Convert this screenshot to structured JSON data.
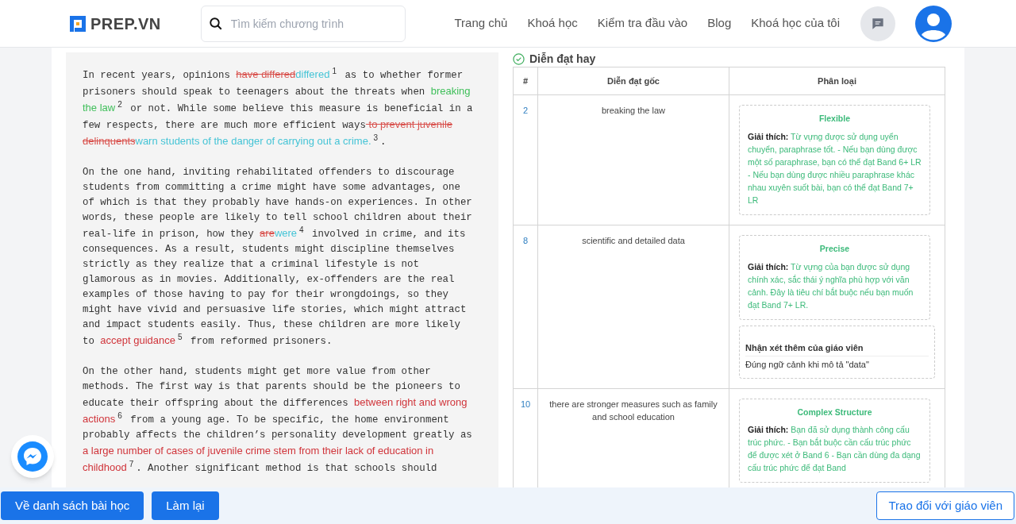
{
  "header": {
    "logo": "PREP.VN",
    "search": {
      "placeholder": "Tìm kiếm chương trình"
    },
    "nav": [
      {
        "label": "Trang chủ"
      },
      {
        "label": "Khoá học"
      },
      {
        "label": "Kiểm tra đầu vào"
      },
      {
        "label": "Blog"
      },
      {
        "label": "Khoá học của tôi"
      }
    ]
  },
  "essay": {
    "paragraphs": [
      [
        {
          "kind": "text",
          "text": "In recent years, opinions "
        },
        {
          "kind": "del",
          "text": "have differed"
        },
        {
          "kind": "ins",
          "text": "differed"
        },
        {
          "kind": "ref",
          "text": "1"
        },
        {
          "kind": "text",
          "text": " as to whether former prisoners should speak to teenagers about the threats when "
        },
        {
          "kind": "good",
          "text": "breaking the law"
        },
        {
          "kind": "ref",
          "text": "2"
        },
        {
          "kind": "text",
          "text": " or not. While some believe this measure is beneficial in a few respects, there are much more efficient ways"
        },
        {
          "kind": "del",
          "text": " to prevent juvenile delinquents"
        },
        {
          "kind": "ins",
          "text": "warn students of the danger of carrying out a crime."
        },
        {
          "kind": "ref",
          "text": "3"
        },
        {
          "kind": "text",
          "text": "."
        }
      ],
      [
        {
          "kind": "text",
          "text": "On the one hand, inviting rehabilitated offenders to discourage students from committing a crime might have some advantages, one of which is that they probably have hands-on experiences. In other words, these people are likely to tell school children about their real-life in prison, how they "
        },
        {
          "kind": "del",
          "text": "are"
        },
        {
          "kind": "ins",
          "text": "were"
        },
        {
          "kind": "ref",
          "text": "4"
        },
        {
          "kind": "text",
          "text": " involved in crime, and its consequences. As a result, students might discipline themselves strictly as they realize that a criminal lifestyle is not glamorous as in movies. Additionally, ex-offenders are the real examples of those having to pay for their wrongdoings, so they might have vivid and persuasive life stories, which might attract and impact students easily. Thus, these children are more likely to "
        },
        {
          "kind": "bad",
          "text": "accept guidance"
        },
        {
          "kind": "ref",
          "text": "5"
        },
        {
          "kind": "text",
          "text": " from reformed prisoners."
        }
      ],
      [
        {
          "kind": "text",
          "text": "On the other hand, students might get more value from other methods. The first way is that parents should be the pioneers to educate their offspring about the differences "
        },
        {
          "kind": "bad",
          "text": "between right and wrong actions"
        },
        {
          "kind": "ref",
          "text": "6"
        },
        {
          "kind": "text",
          "text": " from a young age. To be specific, the home environment probably affects the children’s personality development greatly as "
        },
        {
          "kind": "bad",
          "text": "a large number of cases of juvenile crime stem from their lack of education in childhood"
        },
        {
          "kind": "ref",
          "text": "7"
        },
        {
          "kind": "text",
          "text": ". Another significant method is that schools should"
        }
      ]
    ]
  },
  "review": {
    "title": "Diễn đạt hay",
    "columns": [
      "#",
      "Diễn đạt gốc",
      "Phân loại"
    ],
    "rows": [
      {
        "number": "2",
        "original": "breaking the law",
        "category": "Flexible",
        "explanation_label": "Giải thích:",
        "explanation": "Từ vựng được sử dụng uyển chuyển, paraphrase tốt. - Nếu bạn dùng được một số paraphrase, bạn có thể đạt Band 6+ LR - Nếu bạn dùng được nhiều paraphrase khác nhau xuyên suốt bài, bạn có thể đạt Band 7+ LR"
      },
      {
        "number": "8",
        "original": "scientific and detailed data",
        "category": "Precise",
        "explanation_label": "Giải thích:",
        "explanation": "Từ vựng của bạn được sử dụng chính xác, sắc thái ý nghĩa phù hợp với văn cảnh. Đây là tiêu chí bắt buộc nếu bạn muốn đạt Band 7+ LR.",
        "teacher_note": {
          "title": "Nhận xét thêm của giáo viên",
          "text": "Đúng ngữ cảnh khi mô tả \"data\""
        }
      },
      {
        "number": "10",
        "original": "there are stronger measures such as family and school education",
        "category": "Complex Structure",
        "explanation_label": "Giải thích:",
        "explanation": "Bạn đã sử dụng thành công cấu trúc phức. - Bạn bắt buộc cần cấu trúc phức để được xét ở Band 6 - Bạn cần dùng đa dạng cấu trúc phức để đạt Band"
      }
    ]
  },
  "footer": {
    "buttons": [
      {
        "label": "Về danh sách bài học",
        "kind": "primary"
      },
      {
        "label": "Làm lại",
        "kind": "primary"
      },
      {
        "label": "Trao đổi với giáo viên",
        "kind": "outline"
      }
    ]
  }
}
